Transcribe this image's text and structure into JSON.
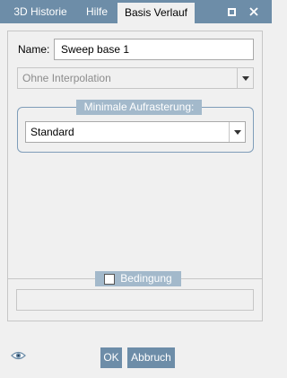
{
  "tabs": [
    {
      "label": "3D Historie"
    },
    {
      "label": "Hilfe"
    },
    {
      "label": "Basis Verlauf",
      "active": true
    }
  ],
  "window": {
    "minimize_icon": "square-icon",
    "close_icon": "square-icon"
  },
  "form": {
    "name_label": "Name:",
    "name_value": "Sweep base 1",
    "interpolation_value": "Ohne Interpolation",
    "raster_group_title": "Minimale Aufrasterung:",
    "raster_value": "Standard",
    "condition_label": "Bedingung",
    "condition_checked": false
  },
  "footer": {
    "preview_icon": "eye-icon",
    "ok_label": "OK",
    "cancel_label": "Abbruch"
  },
  "colors": {
    "accent": "#6d8da8",
    "legend": "#a3b9cb"
  }
}
